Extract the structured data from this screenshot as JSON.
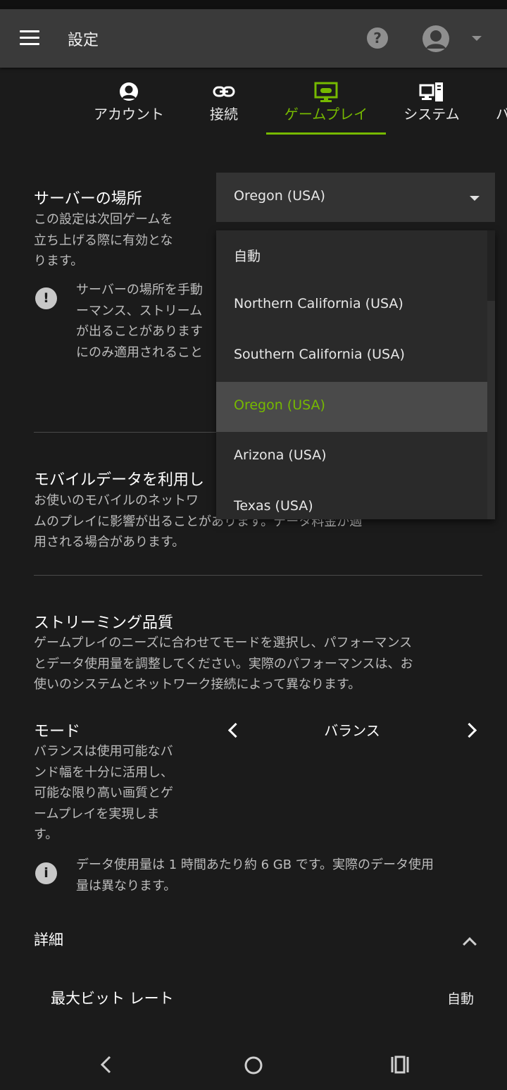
{
  "appbar": {
    "title": "設定"
  },
  "tabs": [
    {
      "label": "アカウント",
      "icon": "account-icon"
    },
    {
      "label": "接続",
      "icon": "link-icon"
    },
    {
      "label": "ゲームプレイ",
      "icon": "gameplay-icon",
      "active": true
    },
    {
      "label": "システム",
      "icon": "system-icon"
    },
    {
      "label": "バ",
      "icon": ""
    }
  ],
  "server": {
    "title": "サーバーの場所",
    "desc_lines": [
      "この設定は次回ゲームを",
      "立ち上げる際に有効とな",
      "ります。"
    ],
    "warning_lines": [
      "サーバーの場所を手動",
      "ーマンス、ストリーム",
      "が出ることがあります",
      "にのみ適用されること"
    ],
    "selected": "Oregon (USA)",
    "options": [
      "自動",
      "Northern California (USA)",
      "Southern California (USA)",
      "Oregon (USA)",
      "Arizona (USA)",
      "Texas (USA)"
    ]
  },
  "mobile": {
    "title": "モバイルデータを利用し",
    "desc_lines": [
      "お使いのモバイルのネットワ",
      "ムのプレイに影響が出ることがあります。データ料金が適",
      "用される場合があります。"
    ]
  },
  "quality": {
    "title": "ストリーミング品質",
    "desc_lines": [
      "ゲームプレイのニーズに合わせてモードを選択し、パフォーマンス",
      "とデータ使用量を調整してください。実際のパフォーマンスは、お",
      "使いのシステムとネットワーク接続によって異なります。"
    ],
    "mode_title": "モード",
    "mode_value": "バランス",
    "mode_desc_lines": [
      "バランスは使用可能なバ",
      "ンド幅を十分に活用し、",
      "可能な限り高い画質とゲ",
      "ームプレイを実現しま",
      "す。"
    ],
    "info_lines": [
      "データ使用量は 1 時間あたり約 6 GB です。実際のデータ使用",
      "量は異なります。"
    ]
  },
  "details": {
    "title": "詳細",
    "max_bitrate_label": "最大ビット レート",
    "max_bitrate_value": "自動"
  },
  "colors": {
    "accent": "#76b900",
    "background": "#1b1b1b",
    "appbar": "#3a3a3a"
  }
}
